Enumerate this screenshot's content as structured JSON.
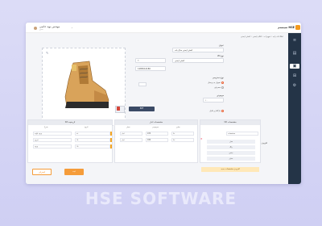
{
  "topbar": {
    "user_name": "مهندس نوید حاتمی",
    "user_role": "مدیر",
    "brand": "سیستم HSE",
    "breadcrumb": "اطلاعات پایه ‹ تجهیزات ‹ اقلام ایمنی ‹ کفش ایمنی"
  },
  "form": {
    "title_label": "عنوان",
    "title_value": "کفش ایمنی ساق بلند",
    "type_label": "نوع کالا",
    "type_value": "کفش ایمنی",
    "code_value": "1285014180",
    "qty_value": "۲۰",
    "radio_group_label": "نوع دسترسی",
    "radio_1": "تحویل به پرسنل",
    "radio_2": "مصرفی",
    "field_label": "موجودی",
    "field_value": "۱۰",
    "upload_label": "بارگذاری فایل",
    "file_label": "PDF",
    "add_label": "افزودن"
  },
  "panels": {
    "left_title": "تاریخچه کالا",
    "left_headers": [
      "تاریخ",
      "شرح"
    ],
    "left_rows": [
      [
        "۲۲",
        "ورود اولیه"
      ],
      [
        "۱۸",
        "خروج"
      ],
      [
        "۱۵",
        "ورود"
      ]
    ],
    "mid_title": "مشخصات انبار",
    "mid_headers": [
      "سایز",
      "موجودی",
      "محل"
    ],
    "mid_rows": [
      [
        "۴۲",
        "220",
        "انبار"
      ],
      [
        "۴۳",
        "180",
        "انبار"
      ]
    ],
    "right_title": "مشخصات کالا",
    "right_items": [
      "مدل",
      "رنگ",
      "جنس",
      "سایز"
    ],
    "right_select": "مشخصات",
    "warning": "افزودن مشخصات جدید"
  },
  "buttons": {
    "cancel": "انصراف",
    "save": "ثبت"
  },
  "watermark": "HSE SOFTWARE",
  "colors": {
    "accent": "#f59c3a",
    "sidebar": "#243447",
    "background": "#d4d4f5"
  }
}
